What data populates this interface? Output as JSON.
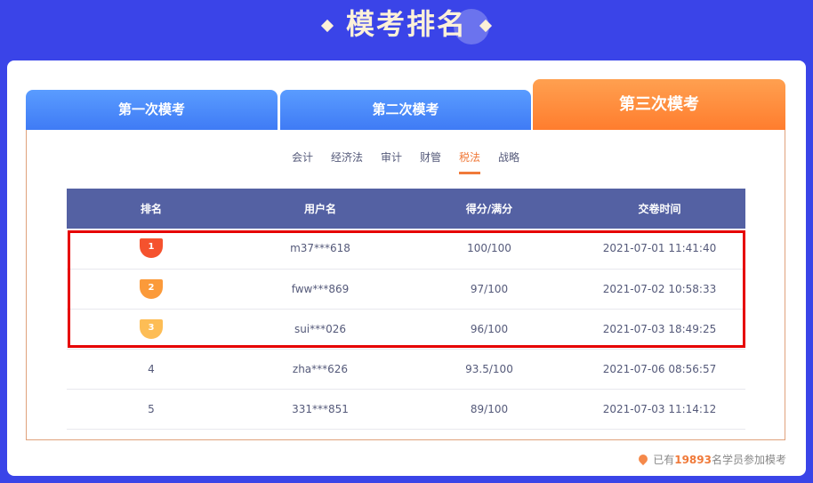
{
  "title": "模考排名",
  "tabs": [
    "第一次模考",
    "第二次模考",
    "第三次模考"
  ],
  "subjects": [
    "会计",
    "经济法",
    "审计",
    "财管",
    "税法",
    "战略"
  ],
  "active_subject": "税法",
  "table": {
    "headers": [
      "排名",
      "用户名",
      "得分/满分",
      "交卷时间"
    ],
    "rows": [
      {
        "rank": "1",
        "user": "m37***618",
        "score": "100/100",
        "time": "2021-07-01 11:41:40"
      },
      {
        "rank": "2",
        "user": "fww***869",
        "score": "97/100",
        "time": "2021-07-02 10:58:33"
      },
      {
        "rank": "3",
        "user": "sui***026",
        "score": "96/100",
        "time": "2021-07-03 18:49:25"
      },
      {
        "rank": "4",
        "user": "zha***626",
        "score": "93.5/100",
        "time": "2021-07-06 08:56:57"
      },
      {
        "rank": "5",
        "user": "331***851",
        "score": "89/100",
        "time": "2021-07-03 11:14:12"
      }
    ]
  },
  "footer": {
    "prefix": "已有",
    "count": "19893",
    "suffix": "名学员参加模考"
  },
  "medal_colors": [
    "#f5522e",
    "#fb9a3a",
    "#fdbd55"
  ]
}
